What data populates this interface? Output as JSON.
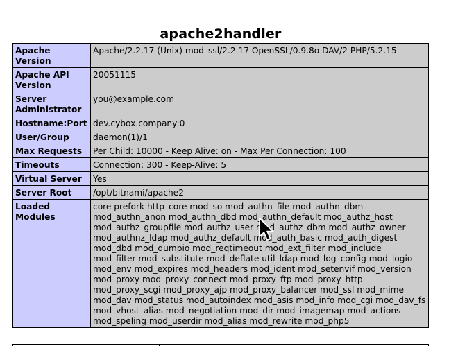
{
  "section": {
    "title": "apache2handler"
  },
  "rows": [
    {
      "key": "Apache Version",
      "value": "Apache/2.2.17 (Unix) mod_ssl/2.2.17 OpenSSL/0.9.8o DAV/2 PHP/5.2.15"
    },
    {
      "key": "Apache API Version",
      "value": "20051115"
    },
    {
      "key": "Server Administrator",
      "value": "you@example.com"
    },
    {
      "key": "Hostname:Port",
      "value": "dev.cybox.company:0"
    },
    {
      "key": "User/Group",
      "value": "daemon(1)/1"
    },
    {
      "key": "Max Requests",
      "value": "Per Child: 10000 - Keep Alive: on - Max Per Connection: 100"
    },
    {
      "key": "Timeouts",
      "value": "Connection: 300 - Keep-Alive: 5"
    },
    {
      "key": "Virtual Server",
      "value": "Yes"
    },
    {
      "key": "Server Root",
      "value": "/opt/bitnami/apache2"
    },
    {
      "key": "Loaded Modules",
      "value": "core prefork http_core mod_so mod_authn_file mod_authn_dbm mod_authn_anon mod_authn_dbd mod_authn_default mod_authz_host mod_authz_groupfile mod_authz_user mod_authz_dbm mod_authz_owner mod_authnz_ldap mod_authz_default mod_auth_basic mod_auth_digest mod_dbd mod_dumpio mod_reqtimeout mod_ext_filter mod_include mod_filter mod_substitute mod_deflate util_ldap mod_log_config mod_logio mod_env mod_expires mod_headers mod_ident mod_setenvif mod_version mod_proxy mod_proxy_connect mod_proxy_ftp mod_proxy_http mod_proxy_scgi mod_proxy_ajp mod_proxy_balancer mod_ssl mod_mime mod_dav mod_status mod_autoindex mod_asis mod_info mod_cgi mod_dav_fs mod_vhost_alias mod_negotiation mod_dir mod_imagemap mod_actions mod_speling mod_userdir mod_alias mod_rewrite mod_php5"
    }
  ],
  "colors": {
    "key_background": "#ccccff",
    "value_background": "#cccccc",
    "border": "#000000"
  },
  "cursor": {
    "icon": "mouse-pointer-icon"
  }
}
